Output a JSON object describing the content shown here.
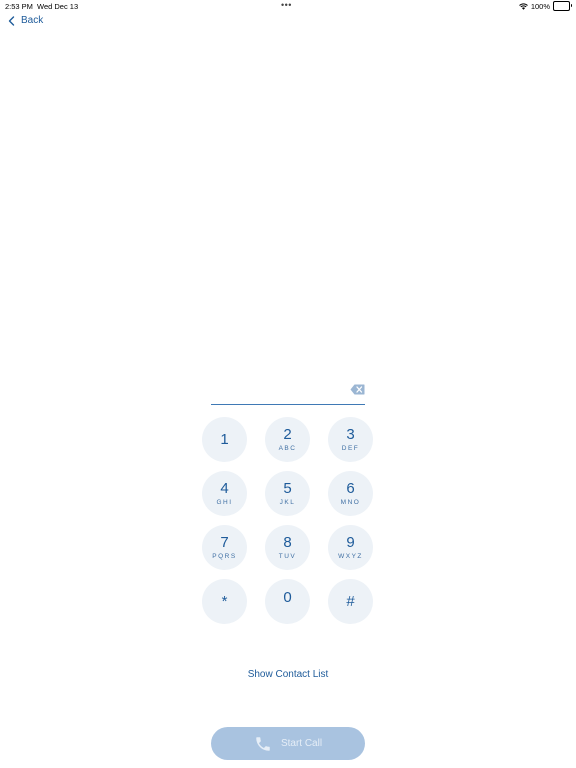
{
  "status_bar": {
    "time": "2:53 PM",
    "date": "Wed Dec 13",
    "multitask_dots": "•••",
    "battery_percent": "100%"
  },
  "nav": {
    "back_label": "Back"
  },
  "dialer": {
    "number_value": "",
    "keys": [
      {
        "digit": "1",
        "letters": ""
      },
      {
        "digit": "2",
        "letters": "ABC"
      },
      {
        "digit": "3",
        "letters": "DEF"
      },
      {
        "digit": "4",
        "letters": "GHI"
      },
      {
        "digit": "5",
        "letters": "JKL"
      },
      {
        "digit": "6",
        "letters": "MNO"
      },
      {
        "digit": "7",
        "letters": "PQRS"
      },
      {
        "digit": "8",
        "letters": "TUV"
      },
      {
        "digit": "9",
        "letters": "WXYZ"
      },
      {
        "digit": "*",
        "letters": ""
      },
      {
        "digit": "0",
        "letters": ""
      },
      {
        "digit": "#",
        "letters": ""
      }
    ]
  },
  "actions": {
    "show_contacts_label": "Show Contact List",
    "start_call_label": "Start Call"
  },
  "colors": {
    "accent": "#1e5b9a",
    "key_background": "#edf2f7",
    "start_call_disabled": "#a9c3e0"
  }
}
